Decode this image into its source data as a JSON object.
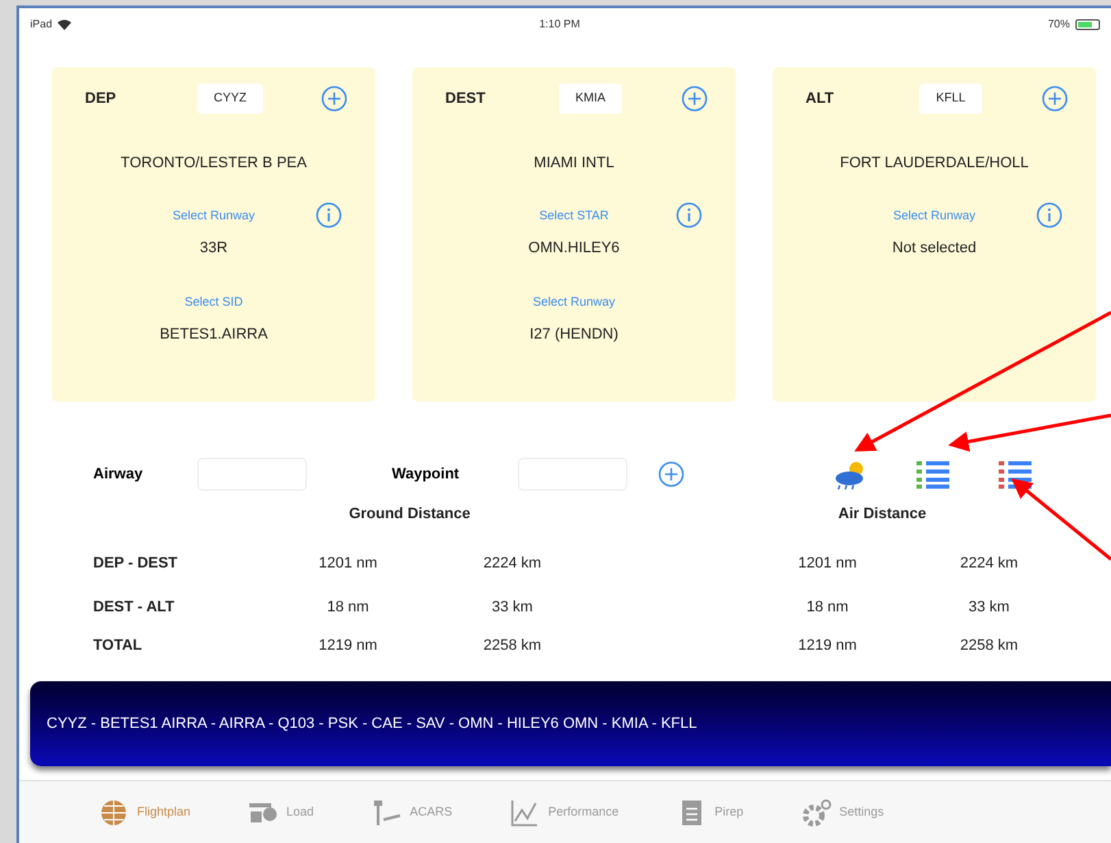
{
  "status_bar": {
    "device": "iPad",
    "time": "1:10 PM",
    "battery": "70%"
  },
  "airports": [
    {
      "label": "DEP",
      "code": "CYYZ",
      "name": "TORONTO/LESTER B PEA",
      "fields": [
        {
          "label": "Select Runway",
          "value": "33R",
          "info": true
        },
        {
          "label": "Select SID",
          "value": "BETES1.AIRRA",
          "info": false
        }
      ]
    },
    {
      "label": "DEST",
      "code": "KMIA",
      "name": "MIAMI INTL",
      "fields": [
        {
          "label": "Select STAR",
          "value": "OMN.HILEY6",
          "info": true
        },
        {
          "label": "Select Runway",
          "value": "I27 (HENDN)",
          "info": false
        }
      ]
    },
    {
      "label": "ALT",
      "code": "KFLL",
      "name": "FORT LAUDERDALE/HOLL",
      "fields": [
        {
          "label": "Select Runway",
          "value": "Not selected",
          "info": true
        }
      ]
    }
  ],
  "airway": {
    "label": "Airway"
  },
  "waypoint": {
    "label": "Waypoint"
  },
  "distances": {
    "ground_title": "Ground Distance",
    "air_title": "Air Distance",
    "rows": [
      {
        "label": "DEP - DEST",
        "ground_nm": "1201 nm",
        "ground_km": "2224 km",
        "air_nm": "1201 nm",
        "air_km": "2224 km"
      },
      {
        "label": "DEST - ALT",
        "ground_nm": "18 nm",
        "ground_km": "33 km",
        "air_nm": "18 nm",
        "air_km": "33 km"
      },
      {
        "label": "TOTAL",
        "ground_nm": "1219 nm",
        "ground_km": "2258 km",
        "air_nm": "1219 nm",
        "air_km": "2258 km"
      }
    ]
  },
  "route": "CYYZ - BETES1 AIRRA - AIRRA - Q103 - PSK - CAE - SAV - OMN - HILEY6 OMN - KMIA - KFLL",
  "tabs": [
    {
      "label": "Flightplan",
      "kind": "globe",
      "selected": true
    },
    {
      "label": "Load",
      "kind": "load",
      "selected": false
    },
    {
      "label": "ACARS",
      "kind": "acars",
      "selected": false
    },
    {
      "label": "Performance",
      "kind": "chart",
      "selected": false
    },
    {
      "label": "Pirep",
      "kind": "doc",
      "selected": false
    },
    {
      "label": "Settings",
      "kind": "gear",
      "selected": false
    }
  ]
}
